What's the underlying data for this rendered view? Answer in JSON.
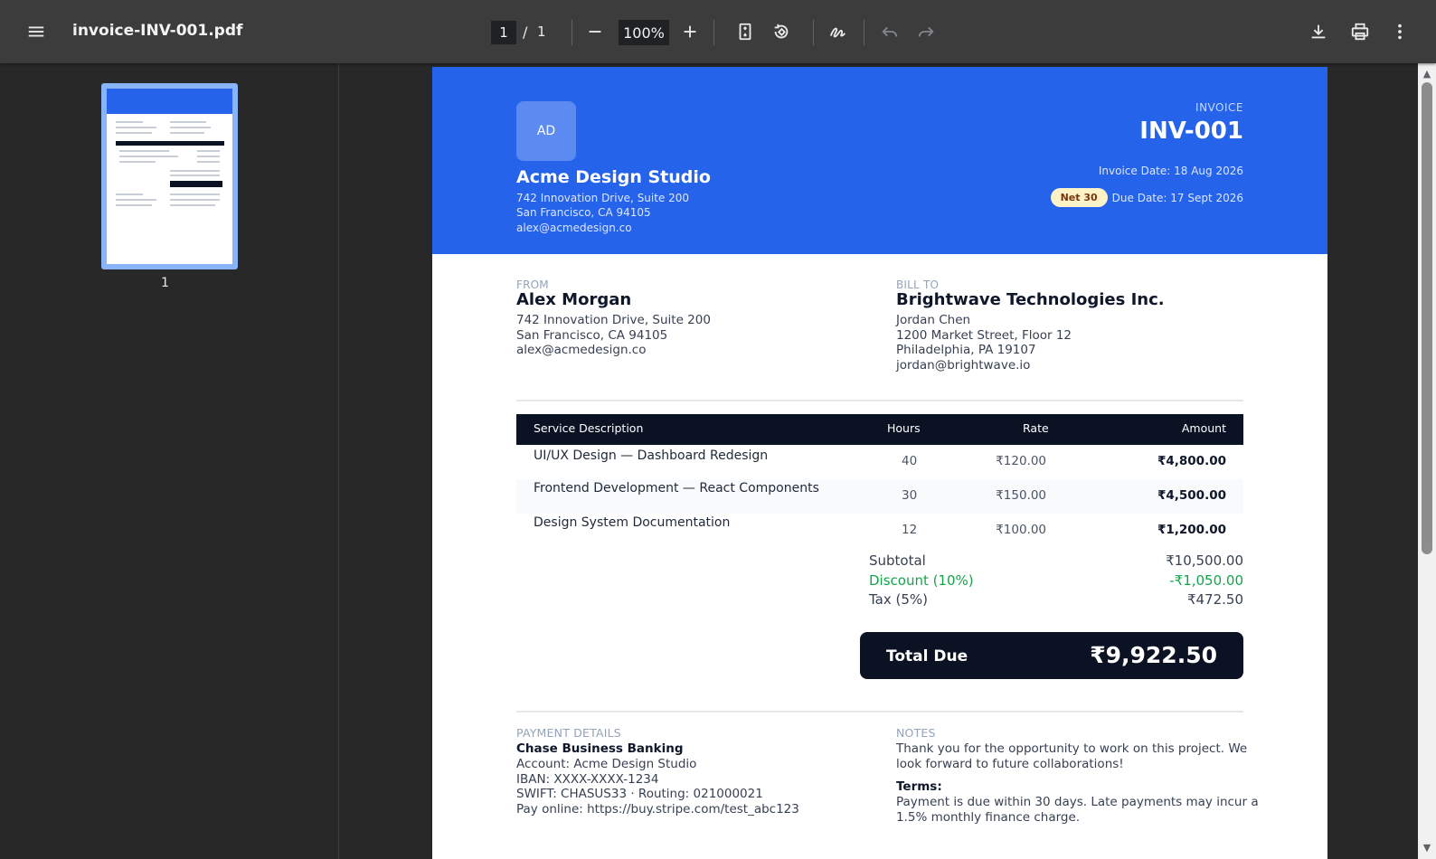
{
  "toolbar": {
    "file_name": "invoice-INV-001.pdf",
    "current_page": "1",
    "page_separator": "/",
    "total_pages": "1",
    "zoom": "100%",
    "icons": [
      "menu-icon",
      "zoom-out-icon",
      "zoom-in-icon",
      "fit-page-icon",
      "rotate-icon",
      "annotate-icon",
      "undo-icon",
      "redo-icon",
      "download-icon",
      "print-icon",
      "more-icon"
    ]
  },
  "sidebar": {
    "thumbnails": [
      {
        "page_label": "1",
        "selected": true
      }
    ]
  },
  "invoice": {
    "logo_initials": "AD",
    "company": {
      "name": "Acme Design Studio",
      "address1": "742 Innovation Drive, Suite 200",
      "address2": "San Francisco, CA 94105",
      "email": "alex@acmedesign.co"
    },
    "label": "INVOICE",
    "number": "INV-001",
    "invoice_date": "Invoice Date: 18 Aug 2026",
    "terms_badge": "Net 30",
    "due_date": "Due Date: 17 Sept 2026",
    "from": {
      "label": "FROM",
      "name": "Alex Morgan",
      "lines": [
        "742 Innovation Drive, Suite 200",
        "San Francisco, CA 94105",
        "alex@acmedesign.co"
      ]
    },
    "bill_to": {
      "label": "BILL TO",
      "name": "Brightwave Technologies Inc.",
      "lines": [
        "Jordan Chen",
        "1200 Market Street, Floor 12",
        "Philadelphia, PA 19107",
        "jordan@brightwave.io"
      ]
    },
    "table": {
      "headers": [
        "Service Description",
        "Hours",
        "Rate",
        "Amount"
      ],
      "rows": [
        {
          "description": "UI/UX Design — Dashboard Redesign",
          "hours": "40",
          "rate": "₹120.00",
          "amount": "₹4,800.00"
        },
        {
          "description": "Frontend Development — React Components",
          "hours": "30",
          "rate": "₹150.00",
          "amount": "₹4,500.00"
        },
        {
          "description": "Design System Documentation",
          "hours": "12",
          "rate": "₹100.00",
          "amount": "₹1,200.00"
        }
      ]
    },
    "summary": {
      "subtotal_label": "Subtotal",
      "subtotal": "₹10,500.00",
      "discount_label": "Discount (10%)",
      "discount": "-₹1,050.00",
      "tax_label": "Tax (5%)",
      "tax": "₹472.50",
      "total_label": "Total Due",
      "total": "₹9,922.50"
    },
    "payment": {
      "label": "PAYMENT DETAILS",
      "bank": "Chase Business Banking",
      "lines": [
        "Account: Acme Design Studio",
        "IBAN: XXXX-XXXX-1234",
        "SWIFT: CHASUS33 · Routing: 021000021",
        "Pay online: https://buy.stripe.com/test_abc123"
      ]
    },
    "notes": {
      "label": "NOTES",
      "lines": [
        "Thank you for the opportunity to work on this project. We",
        "look forward to future collaborations!"
      ],
      "terms_title": "Terms:",
      "terms_lines": [
        "Payment is due within 30 days. Late payments may incur a",
        "1.5% monthly finance charge."
      ]
    }
  },
  "colors": {
    "header_blue": "#2563eb",
    "dark_navy": "#0b1224",
    "discount_green": "#16a34a",
    "badge_bg": "#fef3c7",
    "toolbar_bg": "#3c3c3c",
    "viewer_bg": "#282828"
  }
}
